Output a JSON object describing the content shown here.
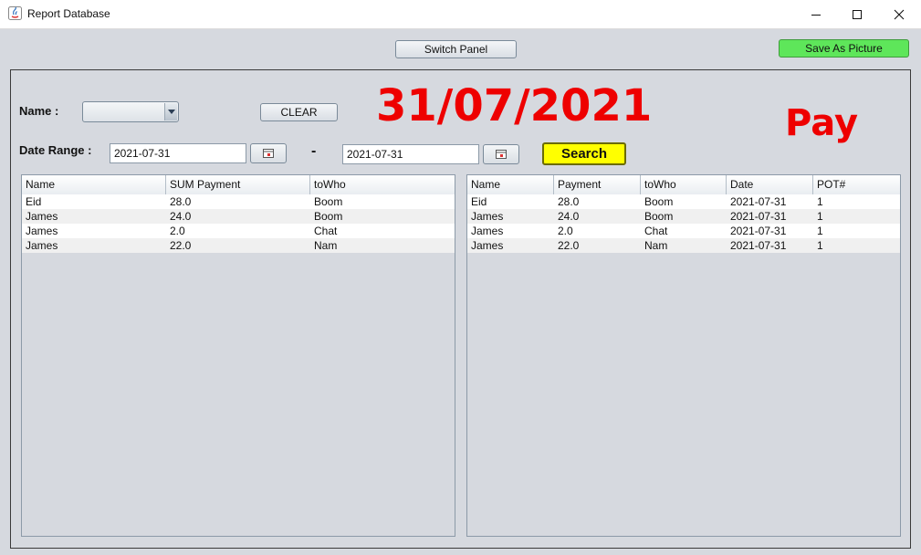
{
  "window": {
    "title": "Report Database"
  },
  "toolbar": {
    "switch_panel": "Switch Panel",
    "save_picture": "Save As Picture",
    "save_color": "#5ee65a"
  },
  "form": {
    "name_label": "Name :",
    "name_value": "",
    "clear_label": "CLEAR",
    "date_range_label": "Date Range :",
    "date_from": "2021-07-31",
    "date_separator": "-",
    "date_to": "2021-07-31",
    "search_label": "Search",
    "search_color": "#ffff00"
  },
  "header_display": {
    "date": "31/07/2021",
    "mode": "Pay",
    "color": "#ee0000"
  },
  "summary_table": {
    "columns": [
      "Name",
      "SUM Payment",
      "toWho"
    ],
    "rows": [
      [
        "Eid",
        "28.0",
        "Boom"
      ],
      [
        "James",
        "24.0",
        "Boom"
      ],
      [
        "James",
        "2.0",
        "Chat"
      ],
      [
        "James",
        "22.0",
        "Nam"
      ]
    ]
  },
  "detail_table": {
    "columns": [
      "Name",
      "Payment",
      "toWho",
      "Date",
      "POT#"
    ],
    "rows": [
      [
        "Eid",
        "28.0",
        "Boom",
        "2021-07-31",
        "1"
      ],
      [
        "James",
        "24.0",
        "Boom",
        "2021-07-31",
        "1"
      ],
      [
        "James",
        "2.0",
        "Chat",
        "2021-07-31",
        "1"
      ],
      [
        "James",
        "22.0",
        "Nam",
        "2021-07-31",
        "1"
      ]
    ]
  }
}
